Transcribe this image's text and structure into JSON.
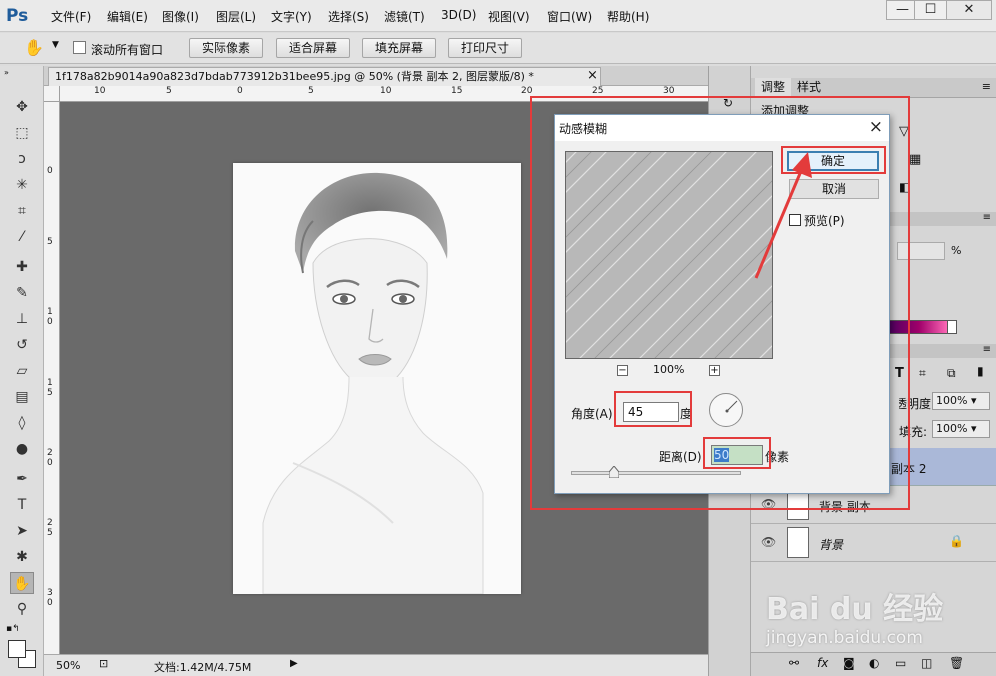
{
  "app": {
    "logo": "Ps",
    "menu": [
      "文件(F)",
      "编辑(E)",
      "图像(I)",
      "图层(L)",
      "文字(Y)",
      "选择(S)",
      "滤镜(T)",
      "3D(D)",
      "视图(V)",
      "窗口(W)",
      "帮助(H)"
    ],
    "window_buttons": [
      "—",
      "☐",
      "✕"
    ]
  },
  "options_bar": {
    "scroll_all_label": "滚动所有窗口",
    "buttons": [
      "实际像素",
      "适合屏幕",
      "填充屏幕",
      "打印尺寸"
    ]
  },
  "document": {
    "tab_title": "1f178a82b9014a90a823d7bdab773912b31bee95.jpg @ 50% (背景 副本 2, 图层蒙版/8) *",
    "tab_close": "×",
    "ruler_h_ticks": [
      "10",
      "5",
      "0",
      "5",
      "10",
      "15",
      "20",
      "25",
      "30"
    ],
    "ruler_v_ticks": [
      "0",
      "5",
      "1 0",
      "1 5",
      "2 0",
      "2 5",
      "3 0"
    ]
  },
  "status": {
    "zoom": "50%",
    "doc_info": "文档:1.42M/4.75M"
  },
  "panels": {
    "tabs": [
      "调整",
      "样式"
    ],
    "add_adjustment": "添加调整",
    "percent_sign": "%",
    "opacity_label": "不透明度:",
    "opacity_value": "100%",
    "fill_label": "填充:",
    "fill_value": "100%",
    "layers": [
      {
        "name": "副本 2",
        "selected": true
      },
      {
        "name": "背景 副本",
        "selected": false
      },
      {
        "name": "背景",
        "selected": false,
        "locked": true
      }
    ]
  },
  "dialog": {
    "title": "动感模糊",
    "ok": "确定",
    "cancel": "取消",
    "preview_label": "预览(P)",
    "zoom_value": "100%",
    "zoom_minus": "−",
    "zoom_plus": "+",
    "angle_label": "角度(A)",
    "angle_value": "45",
    "angle_unit": "度",
    "distance_label": "距离(D):",
    "distance_value": "50",
    "distance_unit": "像素"
  },
  "watermark": {
    "brand": "Bai du 经验",
    "url": "jingyan.baidu.com"
  },
  "colors": {
    "highlight_red": "#e33b3b",
    "ps_blue": "#1f5c9b",
    "layer_selected": "#aab8d8"
  }
}
